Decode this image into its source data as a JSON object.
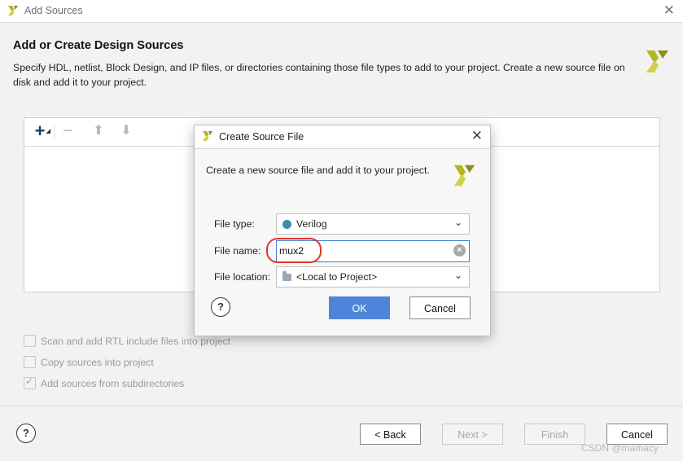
{
  "window": {
    "title": "Add Sources"
  },
  "header": {
    "title": "Add or Create Design Sources",
    "description_line1": "Specify HDL, netlist, Block Design, and IP files, or directories containing those file types to add to your project. Create a new source file on",
    "description_line2": "disk and add it to your project."
  },
  "toolbar": {
    "add": "+",
    "remove": "−",
    "up": "⬆",
    "down": "⬇"
  },
  "options": [
    {
      "label": "Scan and add RTL include files into project",
      "checked": false
    },
    {
      "label": "Copy sources into project",
      "checked": false
    },
    {
      "label": "Add sources from subdirectories",
      "checked": true
    }
  ],
  "footer": {
    "help": "?",
    "back": "< Back",
    "next": "Next >",
    "finish": "Finish",
    "cancel": "Cancel"
  },
  "watermark": "CSDN @mamacy",
  "dialog": {
    "title": "Create Source File",
    "description": "Create a new source file and add it to your project.",
    "file_type_label": "File type:",
    "file_type_value": "Verilog",
    "file_name_label": "File name:",
    "file_name_value": "mux2",
    "file_location_label": "File location:",
    "file_location_value": "<Local to Project>",
    "help": "?",
    "ok": "OK",
    "cancel": "Cancel"
  },
  "colors": {
    "accent": "#4f85d8",
    "annotation": "#e0352b",
    "logo": "#b5b51e"
  }
}
